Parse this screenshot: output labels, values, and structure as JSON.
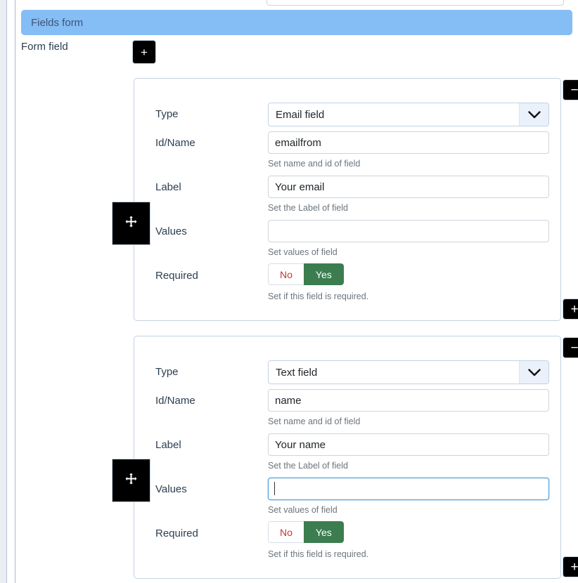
{
  "header": {
    "fields_form_title": "Fields form",
    "form_field_label": "Form field",
    "add_field_button": "+"
  },
  "labels": {
    "type": "Type",
    "id_name": "Id/Name",
    "label": "Label",
    "values": "Values",
    "required": "Required"
  },
  "help": {
    "id_name": "Set name and id of field",
    "label": "Set the Label of field",
    "values": "Set values of field",
    "required": "Set if this field is required."
  },
  "toggle": {
    "no": "No",
    "yes": "Yes"
  },
  "buttons": {
    "remove": "−",
    "add": "+",
    "drag": "move-handle"
  },
  "icons": {
    "chevron": "chevron-down-icon",
    "drag": "move-arrows-icon"
  },
  "colors": {
    "header_bg": "#85bdf5",
    "header_text": "#3e5574",
    "yes_green": "#3b7d4f",
    "no_red": "#c0392b",
    "focus_blue": "#4a9fe0",
    "help_grey": "#6c757d",
    "card_border": "#c3d2e3",
    "page_bg": "#e9eef2"
  },
  "groups": [
    {
      "index": 0,
      "type_value": "Email field",
      "id_name_value": "emailfrom",
      "label_value": "Your email",
      "values_value": "",
      "values_focused": false,
      "required_selected": "Yes"
    },
    {
      "index": 1,
      "type_value": "Text field",
      "id_name_value": "name",
      "label_value": "Your name",
      "values_value": "",
      "values_focused": true,
      "required_selected": "Yes"
    }
  ]
}
